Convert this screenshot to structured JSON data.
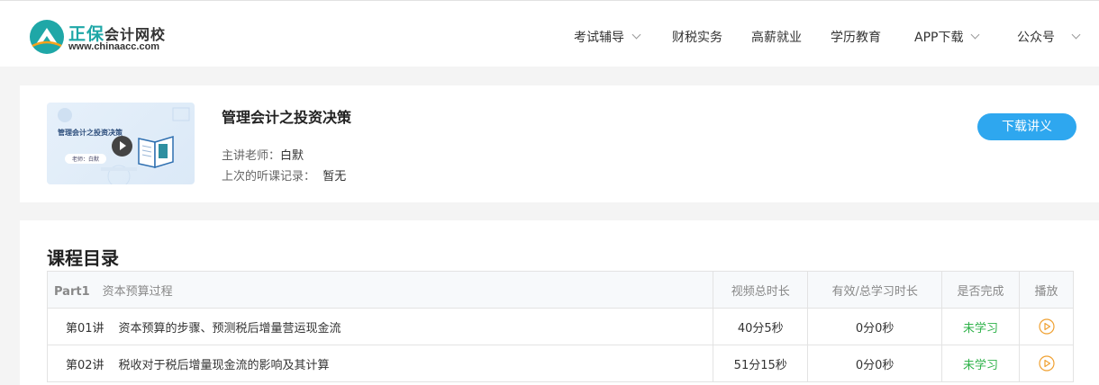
{
  "header": {
    "logo": {
      "name_big": "正保",
      "name_small": "会计网校",
      "url": "www.chinaacc.com"
    },
    "nav": [
      {
        "label": "考试辅导",
        "dropdown": true
      },
      {
        "label": "财税实务",
        "dropdown": false
      },
      {
        "label": "高薪就业",
        "dropdown": false
      },
      {
        "label": "学历教育",
        "dropdown": false
      },
      {
        "label": "APP下载",
        "dropdown": true
      },
      {
        "label": "公众号",
        "dropdown": true
      }
    ]
  },
  "course": {
    "thumbnail": {
      "title": "管理会计之投资决策",
      "teacher": "老师：白默"
    },
    "title": "管理会计之投资决策",
    "teacher_label": "主讲老师：",
    "teacher_name": "白默",
    "history_label": "上次的听课记录：",
    "history_value": "暂无",
    "download_button": "下载讲义"
  },
  "catalog": {
    "title": "课程目录",
    "part_label": "Part1",
    "part_name": "资本预算过程",
    "columns": [
      "视频总时长",
      "有效/总学习时长",
      "是否完成",
      "播放"
    ],
    "lectures": [
      {
        "no": "第01讲",
        "name": "资本预算的步骤、预测税后增量营运现金流",
        "duration": "40分5秒",
        "studied": "0分0秒",
        "status": "未学习"
      },
      {
        "no": "第02讲",
        "name": "税收对于税后增量现金流的影响及其计算",
        "duration": "51分15秒",
        "studied": "0分0秒",
        "status": "未学习"
      }
    ]
  },
  "colors": {
    "accent": "#2ea7ef",
    "logo": "#1fa7a7",
    "status_green": "#2fb24a",
    "play_orange": "#f0a030"
  }
}
